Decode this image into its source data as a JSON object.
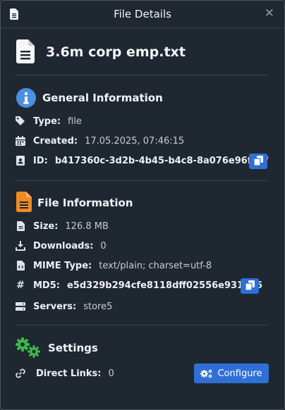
{
  "window": {
    "title": "File Details"
  },
  "file": {
    "name": "3.6m corp emp.txt"
  },
  "general": {
    "title": "General Information",
    "type_label": "Type:",
    "type_value": "file",
    "created_label": "Created:",
    "created_value": "17.05.2025, 07:46:15",
    "id_label": "ID:",
    "id_value": "b417360c-3d2b-4b45-b4c8-8a076e96fe6f"
  },
  "fileinfo": {
    "title": "File Information",
    "size_label": "Size:",
    "size_value": "126.8 MB",
    "downloads_label": "Downloads:",
    "downloads_value": "0",
    "mime_label": "MIME Type:",
    "mime_value": "text/plain; charset=utf-8",
    "md5_label": "MD5:",
    "md5_value": "e5d329b294cfe8118dff02556e9312a6",
    "servers_label": "Servers:",
    "servers_value": "store5"
  },
  "settings": {
    "title": "Settings",
    "direct_links_label": "Direct Links:",
    "direct_links_value": "0",
    "configure_label": "Configure"
  },
  "colors": {
    "accent": "#2f6fd6",
    "info": "#4a90e2",
    "file_orange": "#f08a24",
    "gear_green": "#3cb84a"
  }
}
